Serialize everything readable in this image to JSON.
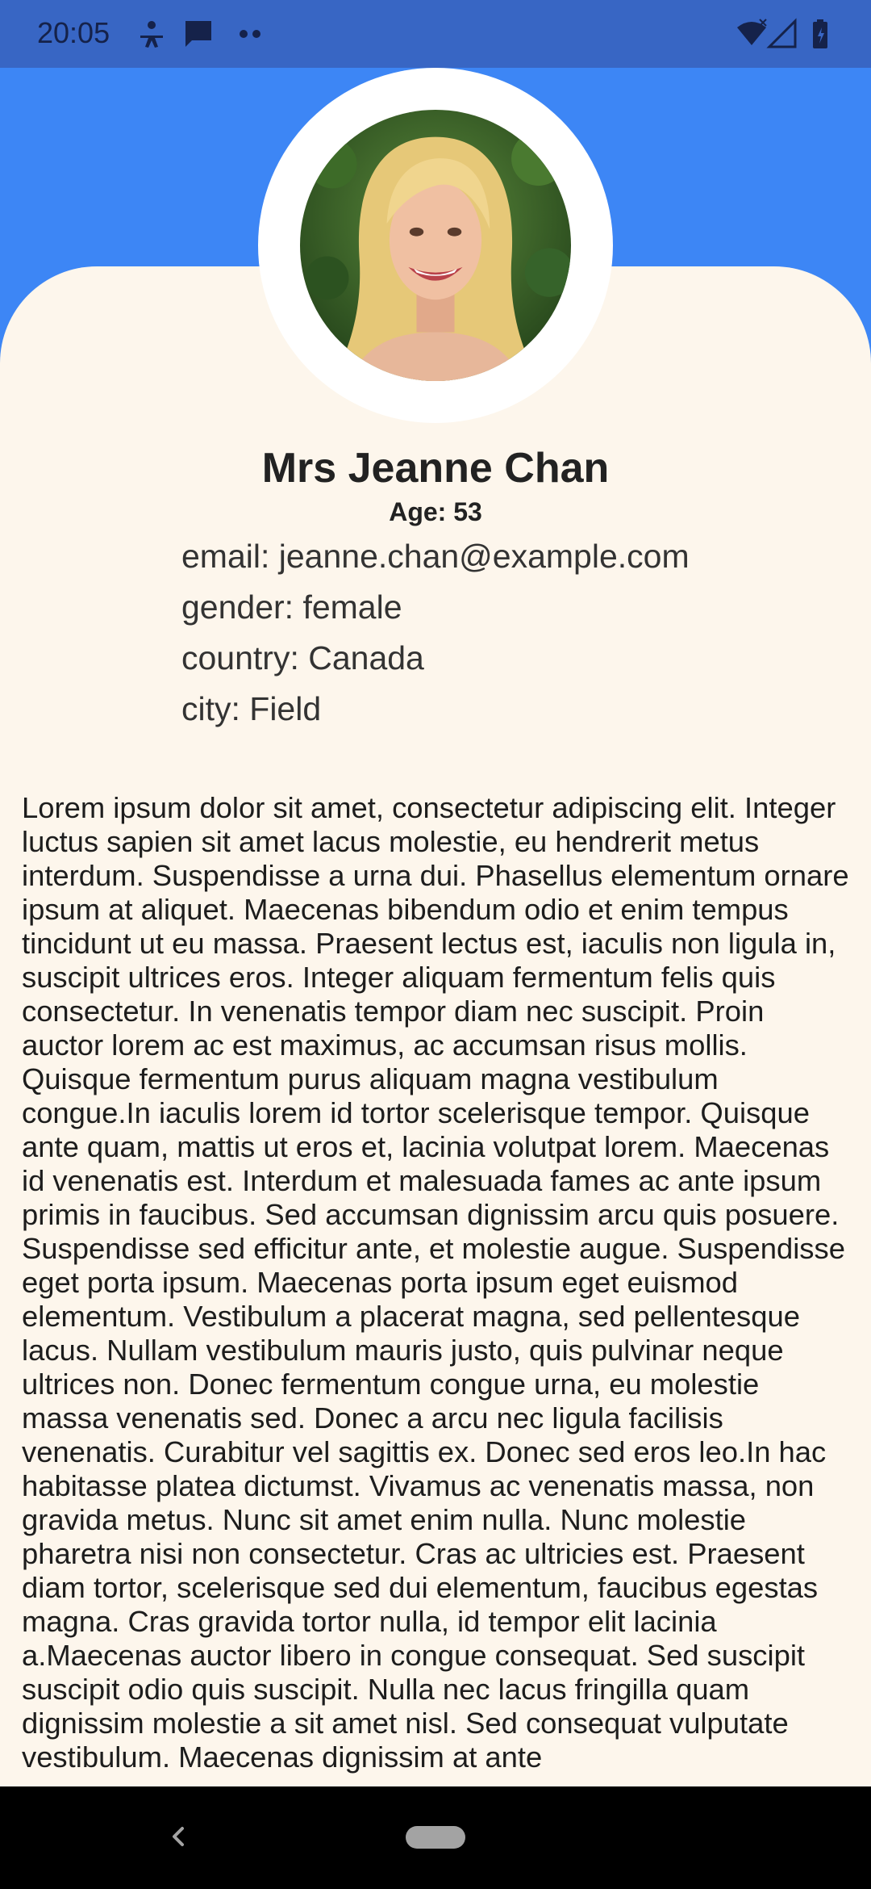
{
  "status_bar": {
    "time": "20:05",
    "left_icons": [
      "person-icon",
      "message-icon",
      "more-dots-icon"
    ],
    "right_icons": [
      "wifi-icon",
      "signal-icon",
      "battery-icon"
    ],
    "background": "#3866c4"
  },
  "header": {
    "background": "#3d86f5"
  },
  "profile": {
    "avatar": "avatar-photo",
    "name": "Mrs Jeanne Chan",
    "age_line": "Age: 53",
    "email_line": "email: jeanne.chan@example.com",
    "gender_line": "gender: female",
    "country_line": "country: Canada",
    "city_line": "city: Field"
  },
  "description": "Lorem ipsum dolor sit amet, consectetur adipiscing elit. Integer luctus sapien sit amet lacus molestie, eu hendrerit metus interdum. Suspendisse a urna dui. Phasellus elementum ornare ipsum at aliquet. Maecenas bibendum odio et enim tempus tincidunt ut eu massa. Praesent lectus est, iaculis non ligula in, suscipit ultrices eros. Integer aliquam fermentum felis quis consectetur. In venenatis tempor diam nec suscipit. Proin auctor lorem ac est maximus, ac accumsan risus mollis. Quisque fermentum purus aliquam magna vestibulum congue.In iaculis lorem id tortor scelerisque tempor. Quisque ante quam, mattis ut eros et, lacinia volutpat lorem. Maecenas id venenatis est. Interdum et malesuada fames ac ante ipsum primis in faucibus. Sed accumsan dignissim arcu quis posuere. Suspendisse sed efficitur ante, et molestie augue. Suspendisse eget porta ipsum. Maecenas porta ipsum eget euismod elementum. Vestibulum a placerat magna, sed pellentesque lacus. Nullam vestibulum mauris justo, quis pulvinar neque ultrices non. Donec fermentum congue urna, eu molestie massa venenatis sed. Donec a arcu nec ligula facilisis venenatis. Curabitur vel sagittis ex. Donec sed eros leo.In hac habitasse platea dictumst. Vivamus ac venenatis massa, non gravida metus. Nunc sit amet enim nulla. Nunc molestie pharetra nisi non consectetur. Cras ac ultricies est. Praesent diam tortor, scelerisque sed dui elementum, faucibus egestas magna. Cras gravida tortor nulla, id tempor elit lacinia a.Maecenas auctor libero in congue consequat. Sed suscipit suscipit odio quis suscipit. Nulla nec lacus fringilla quam dignissim molestie a sit amet nisl. Sed consequat vulputate vestibulum. Maecenas dignissim at ante",
  "nav_bar": {
    "back_icon": "back-icon",
    "home_icon": "home-pill-icon"
  }
}
